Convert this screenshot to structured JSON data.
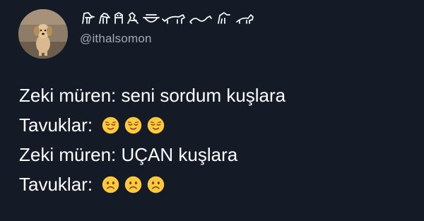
{
  "tweet": {
    "handle": "@ithalsomon",
    "display_name_glyphs": [
      "hieroglyph-bird-1",
      "hieroglyph-bird-2",
      "hieroglyph-owl",
      "hieroglyph-seated-figure",
      "hieroglyph-vessel",
      "hieroglyph-lion",
      "hieroglyph-snake",
      "hieroglyph-bird-3",
      "hieroglyph-cat"
    ],
    "lines": [
      {
        "text": "Zeki müren: seni sordum kuşlara",
        "emojis": []
      },
      {
        "text": "Tavuklar:",
        "emojis": [
          "relieved-face-emoji",
          "relieved-face-emoji",
          "relieved-face-emoji"
        ]
      },
      {
        "text": "Zeki müren: UÇAN kuşlara",
        "emojis": []
      },
      {
        "text": "Tavuklar:",
        "emojis": [
          "frowning-face-emoji",
          "frowning-face-emoji",
          "frowning-face-emoji"
        ]
      }
    ]
  },
  "colors": {
    "background": "#151b26",
    "text": "#ffffff",
    "handle": "#a3aab3",
    "emoji_face": "#ffc83d"
  }
}
